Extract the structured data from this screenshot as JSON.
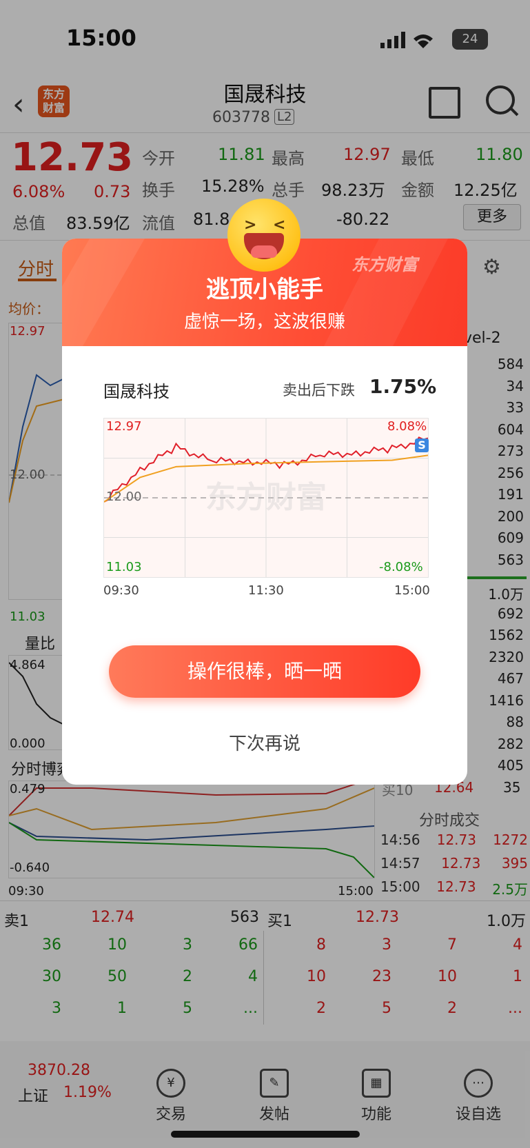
{
  "status_bar": {
    "time": "15:00",
    "battery": "24"
  },
  "header": {
    "logo": "东方财富",
    "stock_name": "国晟科技",
    "stock_code": "603778",
    "level": "L2"
  },
  "quote": {
    "price": "12.73",
    "change_pct": "6.08%",
    "change": "0.73",
    "open_label": "今开",
    "open": "11.81",
    "high_label": "最高",
    "high": "12.97",
    "low_label": "最低",
    "low": "11.80",
    "turnover_label": "换手",
    "turnover": "15.28%",
    "volume_label": "总手",
    "volume": "98.23万",
    "amount_label": "金额",
    "amount": "12.25亿",
    "mktcap_label": "总值",
    "mktcap": "83.59亿",
    "float_label": "流值",
    "float": "81.8",
    "ttm": "-80.22",
    "more_label": "更多"
  },
  "tabs": {
    "intraday": "分时",
    "avg_price": "均价："
  },
  "bg_chart": {
    "high": "12.97",
    "mid": "12.00",
    "low": "11.03",
    "volume_ratio": "量比",
    "vr_top": "4.864",
    "vr_bottom": "0.000",
    "game_label": "分时博弈",
    "game_top": "0.479",
    "game_bottom": "-0.640",
    "start_time": "09:30",
    "end_time": "15:00"
  },
  "right_panel": {
    "level2_label": "vel-2",
    "sell_qty": [
      "584",
      "34",
      "33",
      "604",
      "273",
      "256",
      "191",
      "200",
      "609",
      "563"
    ],
    "buy_qty": [
      "1.0万",
      "692",
      "1562",
      "2320",
      "467",
      "1416",
      "88",
      "282",
      "405"
    ],
    "buy10_label": "买10",
    "buy10_price": "12.64",
    "buy10_qty": "35",
    "trades_title": "分时成交",
    "trades": [
      {
        "time": "14:56",
        "price": "12.73",
        "qty": "1272"
      },
      {
        "time": "14:57",
        "price": "12.73",
        "qty": "395"
      },
      {
        "time": "15:00",
        "price": "12.73",
        "qty": "2.5万"
      }
    ]
  },
  "order_book": {
    "sell1_label": "卖1",
    "sell1_price": "12.74",
    "sell1_qty": "563",
    "buy1_label": "买1",
    "buy1_price": "12.73",
    "buy1_qty": "1.0万",
    "sell_rows": [
      [
        "36",
        "10",
        "3",
        "66"
      ],
      [
        "30",
        "50",
        "2",
        "4"
      ],
      [
        "3",
        "1",
        "5",
        "..."
      ]
    ],
    "buy_rows": [
      [
        "8",
        "3",
        "7",
        "4"
      ],
      [
        "10",
        "23",
        "10",
        "1"
      ],
      [
        "2",
        "5",
        "2",
        "..."
      ]
    ]
  },
  "bottom_nav": {
    "index_value": "3870.28",
    "index_name": "上证",
    "index_pct": "1.19%",
    "trade": "交易",
    "post": "发帖",
    "function": "功能",
    "watchlist": "设自选"
  },
  "modal": {
    "brand": "东方财富",
    "title": "逃顶小能手",
    "subtitle": "虚惊一场，这波很赚",
    "stock_name": "国晟科技",
    "drop_label": "卖出后下跌",
    "drop_value": "1.75%",
    "chart": {
      "high": "12.97",
      "mid": "12.00",
      "low": "11.03",
      "pct_high": "8.08%",
      "pct_low": "-8.08%",
      "t_start": "09:30",
      "t_mid": "11:30",
      "t_end": "15:00",
      "sell_marker": "S"
    },
    "share_button": "操作很棒，晒一晒",
    "later_button": "下次再说"
  },
  "chart_data": {
    "type": "line",
    "x": [
      "09:30",
      "11:30",
      "15:00"
    ],
    "ylim": [
      11.03,
      12.97
    ],
    "series": [
      {
        "values": [
          11.95,
          12.35,
          12.62,
          12.45,
          12.45,
          12.4,
          12.52,
          12.55,
          12.6,
          12.73
        ]
      },
      {
        "values": [
          11.95,
          12.25,
          12.38,
          12.4,
          12.42,
          12.43,
          12.44,
          12.45,
          12.46,
          12.52
        ]
      }
    ]
  },
  "colors": {
    "accent": "#ff4e35",
    "up": "#e02020",
    "down": "#1a9a1a"
  }
}
